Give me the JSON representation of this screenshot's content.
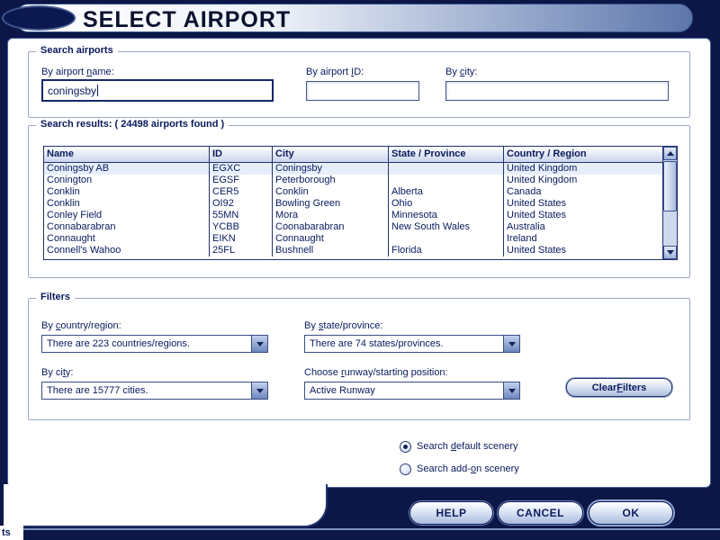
{
  "title": "SELECT AIRPORT",
  "search": {
    "legend": "Search airports",
    "name_label": {
      "pre": "By airport ",
      "key": "n",
      "post": "ame:"
    },
    "id_label": {
      "pre": "By airport ",
      "key": "I",
      "post": "D:"
    },
    "city_label": {
      "pre": "By ",
      "key": "c",
      "post": "ity:"
    },
    "name_value": "coningsby",
    "id_value": "",
    "city_value": ""
  },
  "results": {
    "legend": "Search results: ( 24498 airports found )",
    "columns": [
      "Name",
      "ID",
      "City",
      "State / Province",
      "Country / Region"
    ],
    "rows": [
      [
        "Coningsby AB",
        "EGXC",
        "Coningsby",
        "",
        "United Kingdom"
      ],
      [
        "Conington",
        "EGSF",
        "Peterborough",
        "",
        "United Kingdom"
      ],
      [
        "Conklin",
        "CER5",
        "Conklin",
        "Alberta",
        "Canada"
      ],
      [
        "Conklin",
        "OI92",
        "Bowling Green",
        "Ohio",
        "United States"
      ],
      [
        "Conley Field",
        "55MN",
        "Mora",
        "Minnesota",
        "United States"
      ],
      [
        "Connabarabran",
        "YCBB",
        "Coonabarabran",
        "New South Wales",
        "Australia"
      ],
      [
        "Connaught",
        "EIKN",
        "Connaught",
        "",
        "Ireland"
      ],
      [
        "Connell's Wahoo",
        "25FL",
        "Bushnell",
        "Florida",
        "United States"
      ]
    ]
  },
  "filters": {
    "legend": "Filters",
    "country_label": {
      "pre": "By ",
      "key": "c",
      "post": "ountry/region:"
    },
    "country_value": "There are 223 countries/regions.",
    "state_label": {
      "pre": "By ",
      "key": "s",
      "post": "tate/province:"
    },
    "state_value": "There are 74 states/provinces.",
    "city_label": {
      "pre": "By ci",
      "key": "t",
      "post": "y:"
    },
    "city_value": "There are 15777 cities.",
    "runway_label": {
      "pre": "Choose ",
      "key": "r",
      "post": "unway/starting position:"
    },
    "runway_value": "Active Runway",
    "clear_button": {
      "pre": "Clear ",
      "key": "F",
      "post": "ilters"
    }
  },
  "scenery": {
    "default_label": {
      "pre": "Search ",
      "key": "d",
      "post": "efault scenery"
    },
    "addon_label": {
      "pre": "Search add-",
      "key": "o",
      "post": "n scenery"
    }
  },
  "buttons": {
    "help": "HELP",
    "cancel": "CANCEL",
    "ok": "OK"
  },
  "misc": {
    "corner_text": "ts"
  }
}
